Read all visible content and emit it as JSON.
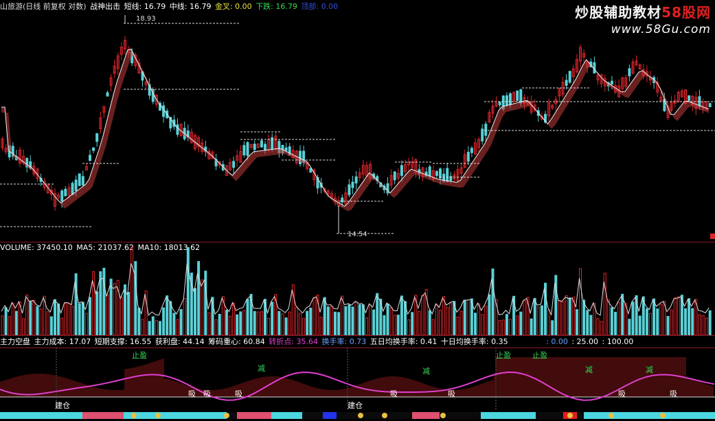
{
  "top_info": {
    "stock_name": "山旅游(日线 前复权 对数)",
    "indicator_name": "战神出击",
    "short_label": "短线: 16.79",
    "mid_label": "中线: 16.79",
    "gold_label": "金叉: 0.00",
    "down_label": "下跌: 16.79",
    "extra_label": "顶部: 0.00"
  },
  "watermark": {
    "logo_main": "炒股辅助教材",
    "logo_red": "58股网",
    "url": "www.58Gu.com"
  },
  "price_marks": {
    "high": "18.93",
    "low": "14.54"
  },
  "vol_info": {
    "volume": "VOLUME: 37450.10",
    "ma5": "MA5: 21037.62",
    "ma10": "MA10: 18013.62"
  },
  "ind_info": {
    "a": "主力空盘",
    "b": "主力成本: 17.07",
    "c": "短期支撑: 16.55",
    "d": "获利盘: 44.14",
    "e": "筹码重心: 60.84",
    "f": "转折点: 35.64",
    "g": "换手率: 0.73",
    "h": "五日均换手率: 0.41",
    "i": "十日均换手率: 0.35",
    "j": ": 0.00",
    "k": ": 25.00",
    "l": ": 100.00"
  },
  "signals": {
    "stop_profit": "止盈",
    "reduce": "减",
    "absorb": "吸",
    "build": "建仓"
  },
  "colors": {
    "up": "#e0262c",
    "down": "#59d0d6",
    "ma_white": "#f0f0f0",
    "ribbon": "#c23a3a",
    "magenta": "#e040d0",
    "green_text": "#33dd55"
  }
}
